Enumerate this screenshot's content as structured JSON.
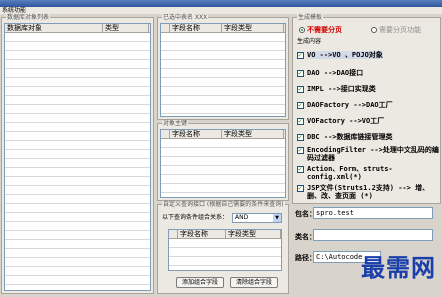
{
  "menu": {
    "title": "系统功能"
  },
  "left_panel": {
    "title": "数据库对象列表",
    "columns": [
      "数据库对象",
      "类型"
    ]
  },
  "mid_top_panel": {
    "title": "已选中表名 XXX",
    "columns": [
      "字段名称",
      "字段类型"
    ]
  },
  "object_panel": {
    "title": "对象主键",
    "columns": [
      "字段名称",
      "字段类型"
    ]
  },
  "query_panel": {
    "title": "自定义查询接口 (根据自己需要的条件来查询)",
    "combine_label": "以下查询条件组合关系：",
    "combine_value": "AND",
    "columns": [
      "字段名称",
      "字段类型"
    ],
    "add_button": "添加组合字段",
    "remove_button": "清除组合字段"
  },
  "right_panel": {
    "title": "生成模板",
    "radio_no_paging": "不需要分页",
    "radio_paging": "需要分页功能",
    "gen_title": "生成内容",
    "options": [
      "VO -->VO 、POJO对象",
      "DAO -->DAO接口",
      "IMPL -->接口实现类",
      "DAOFactory -->DAO工厂",
      "VOFactory -->VO工厂",
      "DBC -->数据库链接管理类",
      "EncodingFilter -->处理中文乱码的编码过滤器",
      "Action、Form、struts-config.xml(*)",
      "JSP文件(Struts1.2支持) --> 增、删、改、查页面 (*)"
    ]
  },
  "form": {
    "package_label": "包名：",
    "package_value": "spro.test",
    "class_label": "类名：",
    "class_value": "",
    "path_label": "路径：",
    "path_value": "C:\\Autocode"
  },
  "watermark": "最需网"
}
